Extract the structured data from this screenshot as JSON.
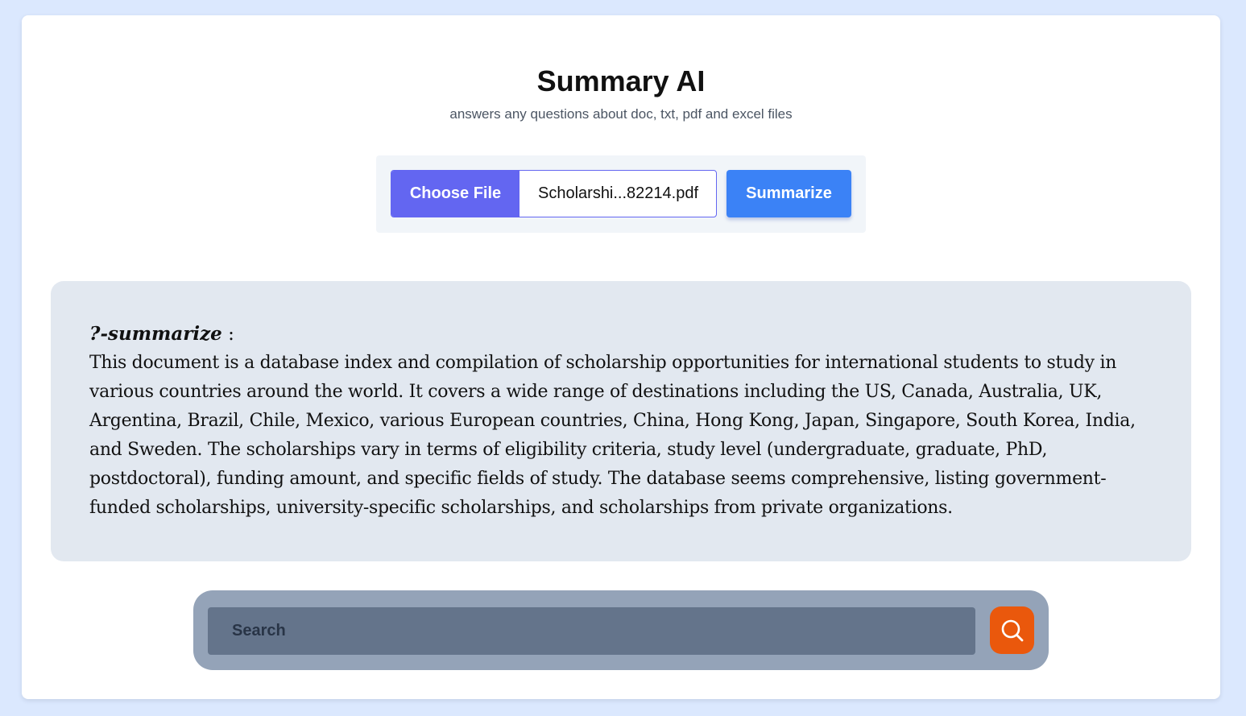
{
  "header": {
    "title": "Summary AI",
    "subtitle": "answers any questions about doc, txt, pdf and excel files"
  },
  "upload": {
    "choose_file_label": "Choose File",
    "selected_file": "Scholarshi...82214.pdf",
    "summarize_label": "Summarize"
  },
  "summary": {
    "command": "?-summarize",
    "separator": " :",
    "text": "This document is a database index and compilation of scholarship opportunities for international students to study in various countries around the world. It covers a wide range of destinations including the US, Canada, Australia, UK, Argentina, Brazil, Chile, Mexico, various European countries, China, Hong Kong, Japan, Singapore, South Korea, India, and Sweden. The scholarships vary in terms of eligibility criteria, study level (undergraduate, graduate, PhD, postdoctoral), funding amount, and specific fields of study. The database seems comprehensive, listing government-funded scholarships, university-specific scholarships, and scholarships from private organizations."
  },
  "search": {
    "value": "",
    "placeholder": "Search",
    "button_icon": "search-icon"
  },
  "colors": {
    "page_background": "#dbe8fe",
    "choose_file": "#6366f1",
    "summarize": "#3b82f6",
    "summary_panel": "#e2e8f0",
    "search_bar": "#94a3b8",
    "search_input": "#64748b",
    "search_button": "#ea580c"
  }
}
